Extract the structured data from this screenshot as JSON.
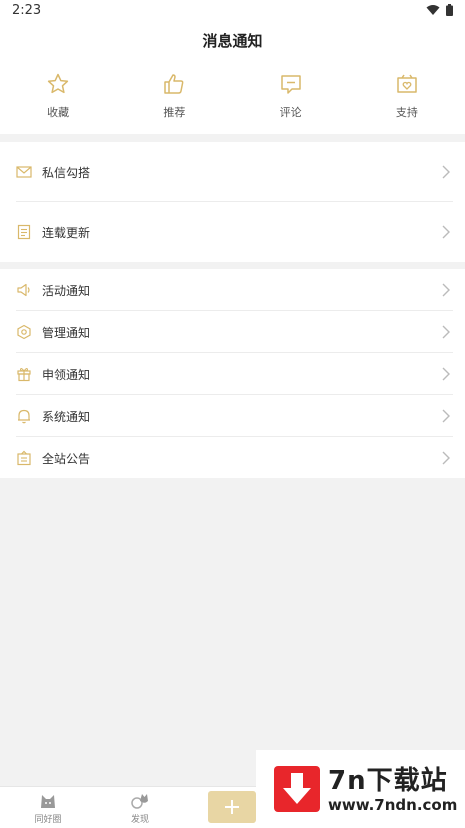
{
  "status_bar": {
    "time": "2:23"
  },
  "header": {
    "title": "消息通知"
  },
  "top_actions": [
    {
      "icon": "star-icon",
      "label": "收藏"
    },
    {
      "icon": "thumbs-up-icon",
      "label": "推荐"
    },
    {
      "icon": "comment-icon",
      "label": "评论"
    },
    {
      "icon": "heart-box-icon",
      "label": "支持"
    }
  ],
  "group1": [
    {
      "icon": "mail-icon",
      "label": "私信勾搭"
    },
    {
      "icon": "document-icon",
      "label": "连载更新"
    }
  ],
  "group2": [
    {
      "icon": "speaker-icon",
      "label": "活动通知"
    },
    {
      "icon": "hexagon-icon",
      "label": "管理通知"
    },
    {
      "icon": "gift-icon",
      "label": "申领通知"
    },
    {
      "icon": "bell-icon",
      "label": "系统通知"
    },
    {
      "icon": "announcement-icon",
      "label": "全站公告"
    }
  ],
  "bottom_nav": [
    {
      "icon": "cat-icon",
      "label": "同好圈"
    },
    {
      "icon": "cat-ring-icon",
      "label": "发现"
    }
  ],
  "watermark": {
    "title": "7n下载站",
    "url": "www.7ndn.com"
  },
  "colors": {
    "accent": "#d9b86a",
    "watermark_red": "#e8262b"
  }
}
